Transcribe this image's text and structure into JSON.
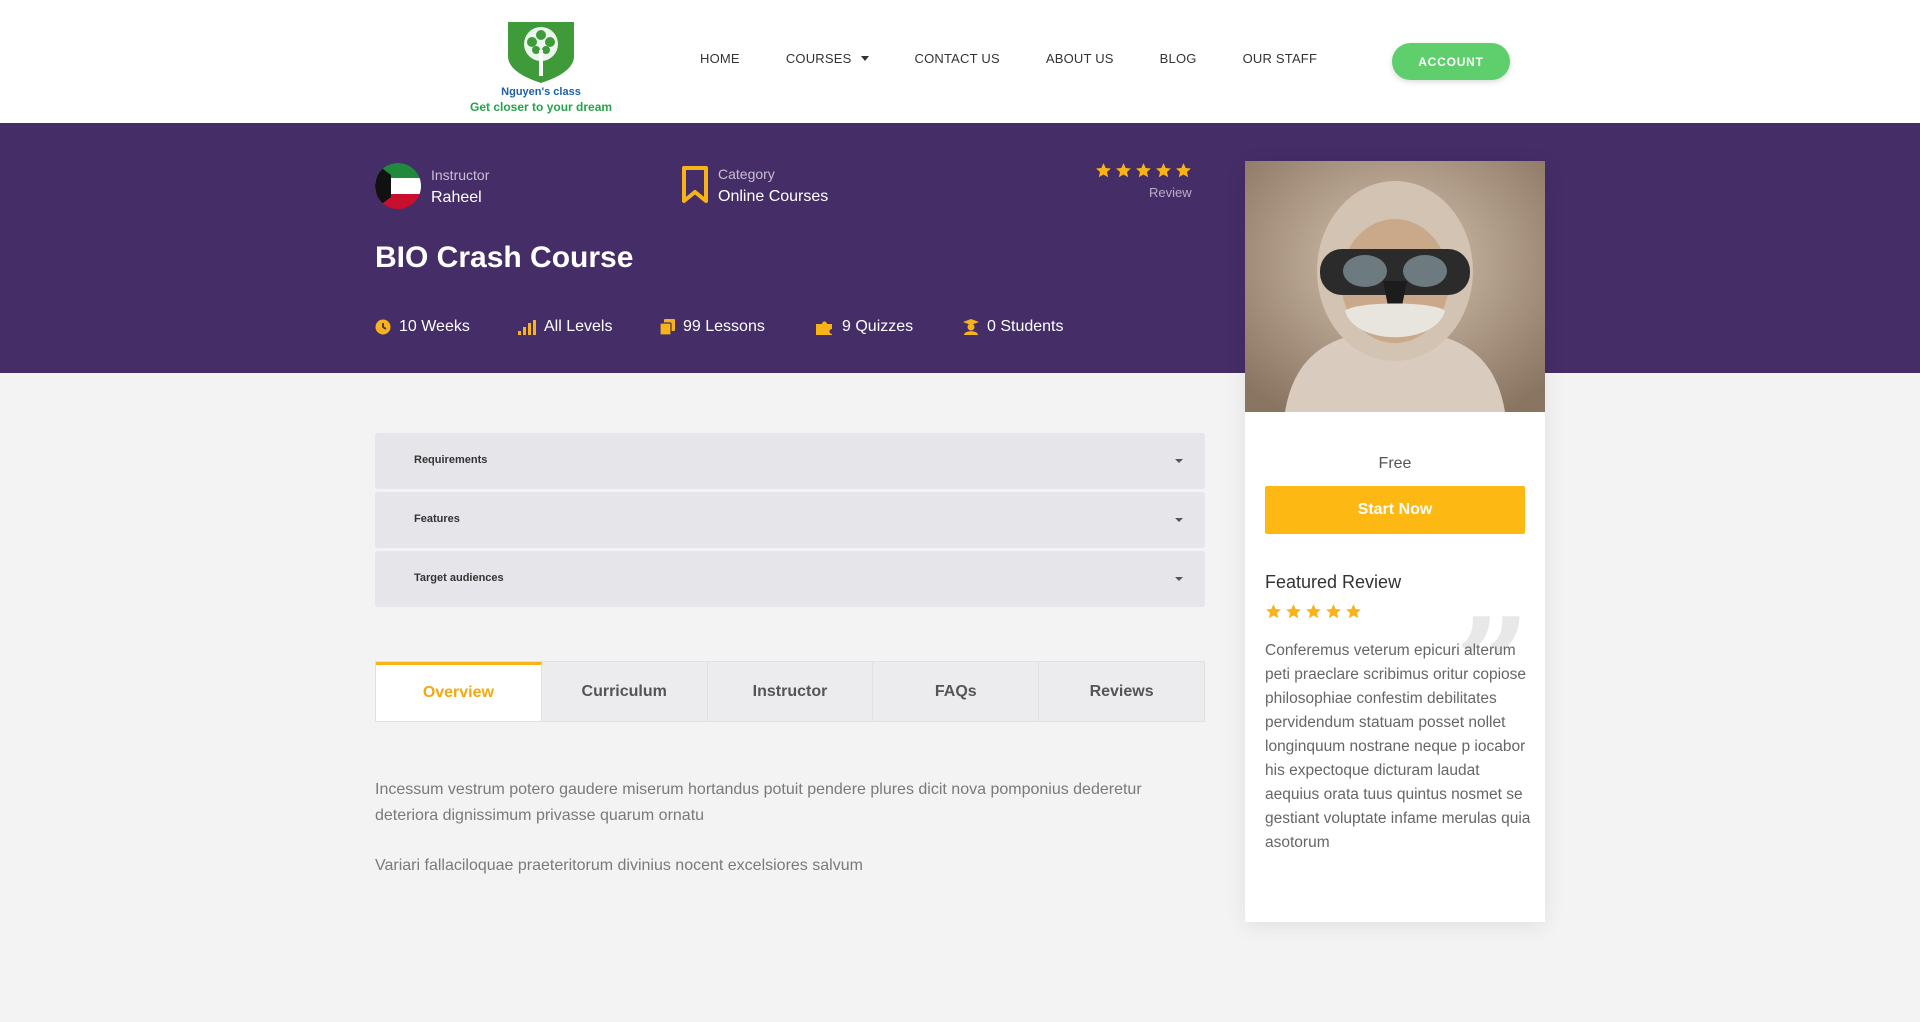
{
  "header": {
    "logo_line1": "Nguyen's class",
    "logo_line2": "Get closer to your dream",
    "nav": [
      {
        "label": "HOME"
      },
      {
        "label": "COURSES",
        "has_dropdown": true
      },
      {
        "label": "CONTACT US"
      },
      {
        "label": "ABOUT US"
      },
      {
        "label": "BLOG"
      },
      {
        "label": "OUR STAFF"
      }
    ],
    "account_label": "ACCOUNT"
  },
  "hero": {
    "instructor_label": "Instructor",
    "instructor_name": "Raheel",
    "category_label": "Category",
    "category_value": "Online Courses",
    "review_label": "Review",
    "rating": 5,
    "title": "BIO Crash Course",
    "stats": {
      "duration": "10 Weeks",
      "level": "All Levels",
      "lessons": "99 Lessons",
      "quizzes": "9 Quizzes",
      "students": "0 Students"
    }
  },
  "accordion": [
    {
      "label": "Requirements"
    },
    {
      "label": "Features"
    },
    {
      "label": "Target audiences"
    }
  ],
  "tabs": [
    {
      "label": "Overview",
      "active": true
    },
    {
      "label": "Curriculum"
    },
    {
      "label": "Instructor"
    },
    {
      "label": "FAQs"
    },
    {
      "label": "Reviews"
    }
  ],
  "overview": {
    "p1": "Incessum vestrum potero gaudere miserum hortandus potuit pendere plures dicit nova pomponius dederetur deteriora dignissimum privasse quarum ornatu",
    "p2": "Variari fallaciloquae praeteritorum divinius nocent excelsiores salvum"
  },
  "sidebar": {
    "price": "Free",
    "start_label": "Start Now",
    "featured_review_title": "Featured Review",
    "featured_review_rating": 5,
    "featured_review_text": "Conferemus veterum epicuri alterum peti praeclare scribimus oritur copiose philosophiae confestim debilitates pervidendum statuam posset nollet longinquum nostrane neque p iocabor his expectoque dicturam laudat aequius orata tuus quintus nosmet se gestiant voluptate infame merulas quia asotorum"
  },
  "colors": {
    "hero_bg": "#452d67",
    "accent_yellow": "#fdb813",
    "account_green": "#5fce6c"
  }
}
